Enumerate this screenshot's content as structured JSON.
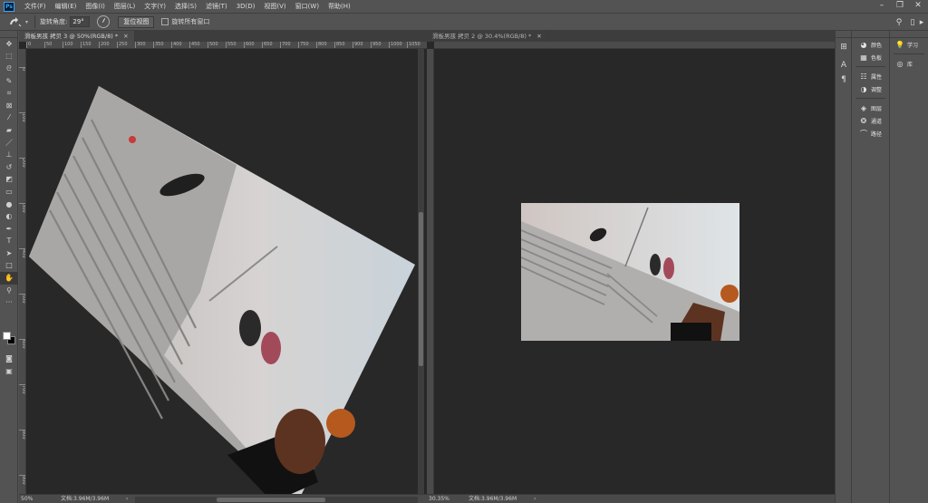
{
  "menubar": {
    "app_icon": "Ps",
    "items": [
      "文件(F)",
      "编辑(E)",
      "图像(I)",
      "图层(L)",
      "文字(Y)",
      "选择(S)",
      "滤镜(T)",
      "3D(D)",
      "视图(V)",
      "窗口(W)",
      "帮助(H)"
    ],
    "window_controls": [
      "minimize-icon",
      "restore-icon",
      "close-icon"
    ]
  },
  "optionsbar": {
    "tool_icon": "rotate-view-icon",
    "angle_label": "旋转角度:",
    "angle_value": "29°",
    "reset_button": "复位视图",
    "rotate_all_label": "旋转所有窗口",
    "rotate_all_checked": false,
    "right_icons": [
      "search-icon",
      "workspace-icon",
      "share-icon"
    ]
  },
  "toolbar": {
    "tools": [
      "move-icon",
      "marquee-icon",
      "lasso-icon",
      "quick-select-icon",
      "crop-icon",
      "frame-icon",
      "eyedropper-icon",
      "healing-brush-icon",
      "brush-icon",
      "clone-stamp-icon",
      "history-brush-icon",
      "eraser-icon",
      "gradient-icon",
      "blur-icon",
      "dodge-icon",
      "pen-icon",
      "type-icon",
      "path-select-icon",
      "rectangle-icon",
      "hand-icon",
      "zoom-icon",
      "more-tools-icon"
    ],
    "active_tool": "hand-icon",
    "foreground_color": "#ffffff",
    "background_color": "#000000"
  },
  "documents": [
    {
      "tab_title": "滑板男孩 拷贝 3 @ 50%(RGB/8) *",
      "ruler_h": [
        "0",
        "50",
        "100",
        "150",
        "200",
        "250",
        "300",
        "350",
        "400",
        "450",
        "500",
        "550",
        "600",
        "650",
        "700",
        "750",
        "800",
        "850",
        "900",
        "950",
        "1000",
        "1050"
      ],
      "status_zoom": "50%",
      "status_doc": "文档:3.96M/3.96M",
      "rotation_deg": 29
    },
    {
      "tab_title": "滑板男孩 拷贝 2 @ 30.4%(RGB/8) *",
      "ruler_h": [],
      "status_zoom": "30.35%",
      "status_doc": "文档:3.96M/3.96M",
      "rotation_deg": 0
    }
  ],
  "panels": {
    "strip": [
      "history-icon",
      "character-icon",
      "paragraph-icon"
    ],
    "dock_groups": [
      [
        {
          "icon": "color-icon",
          "label": "颜色"
        },
        {
          "icon": "swatches-icon",
          "label": "色板"
        }
      ],
      [
        {
          "icon": "properties-icon",
          "label": "属性"
        },
        {
          "icon": "adjustments-icon",
          "label": "调整"
        }
      ],
      [
        {
          "icon": "layers-icon",
          "label": "图层"
        },
        {
          "icon": "channels-icon",
          "label": "通道"
        },
        {
          "icon": "paths-icon",
          "label": "路径"
        }
      ]
    ],
    "dock2": [
      {
        "icon": "learn-icon",
        "label": "学习"
      },
      {
        "icon": "libraries-icon",
        "label": "库"
      }
    ]
  }
}
